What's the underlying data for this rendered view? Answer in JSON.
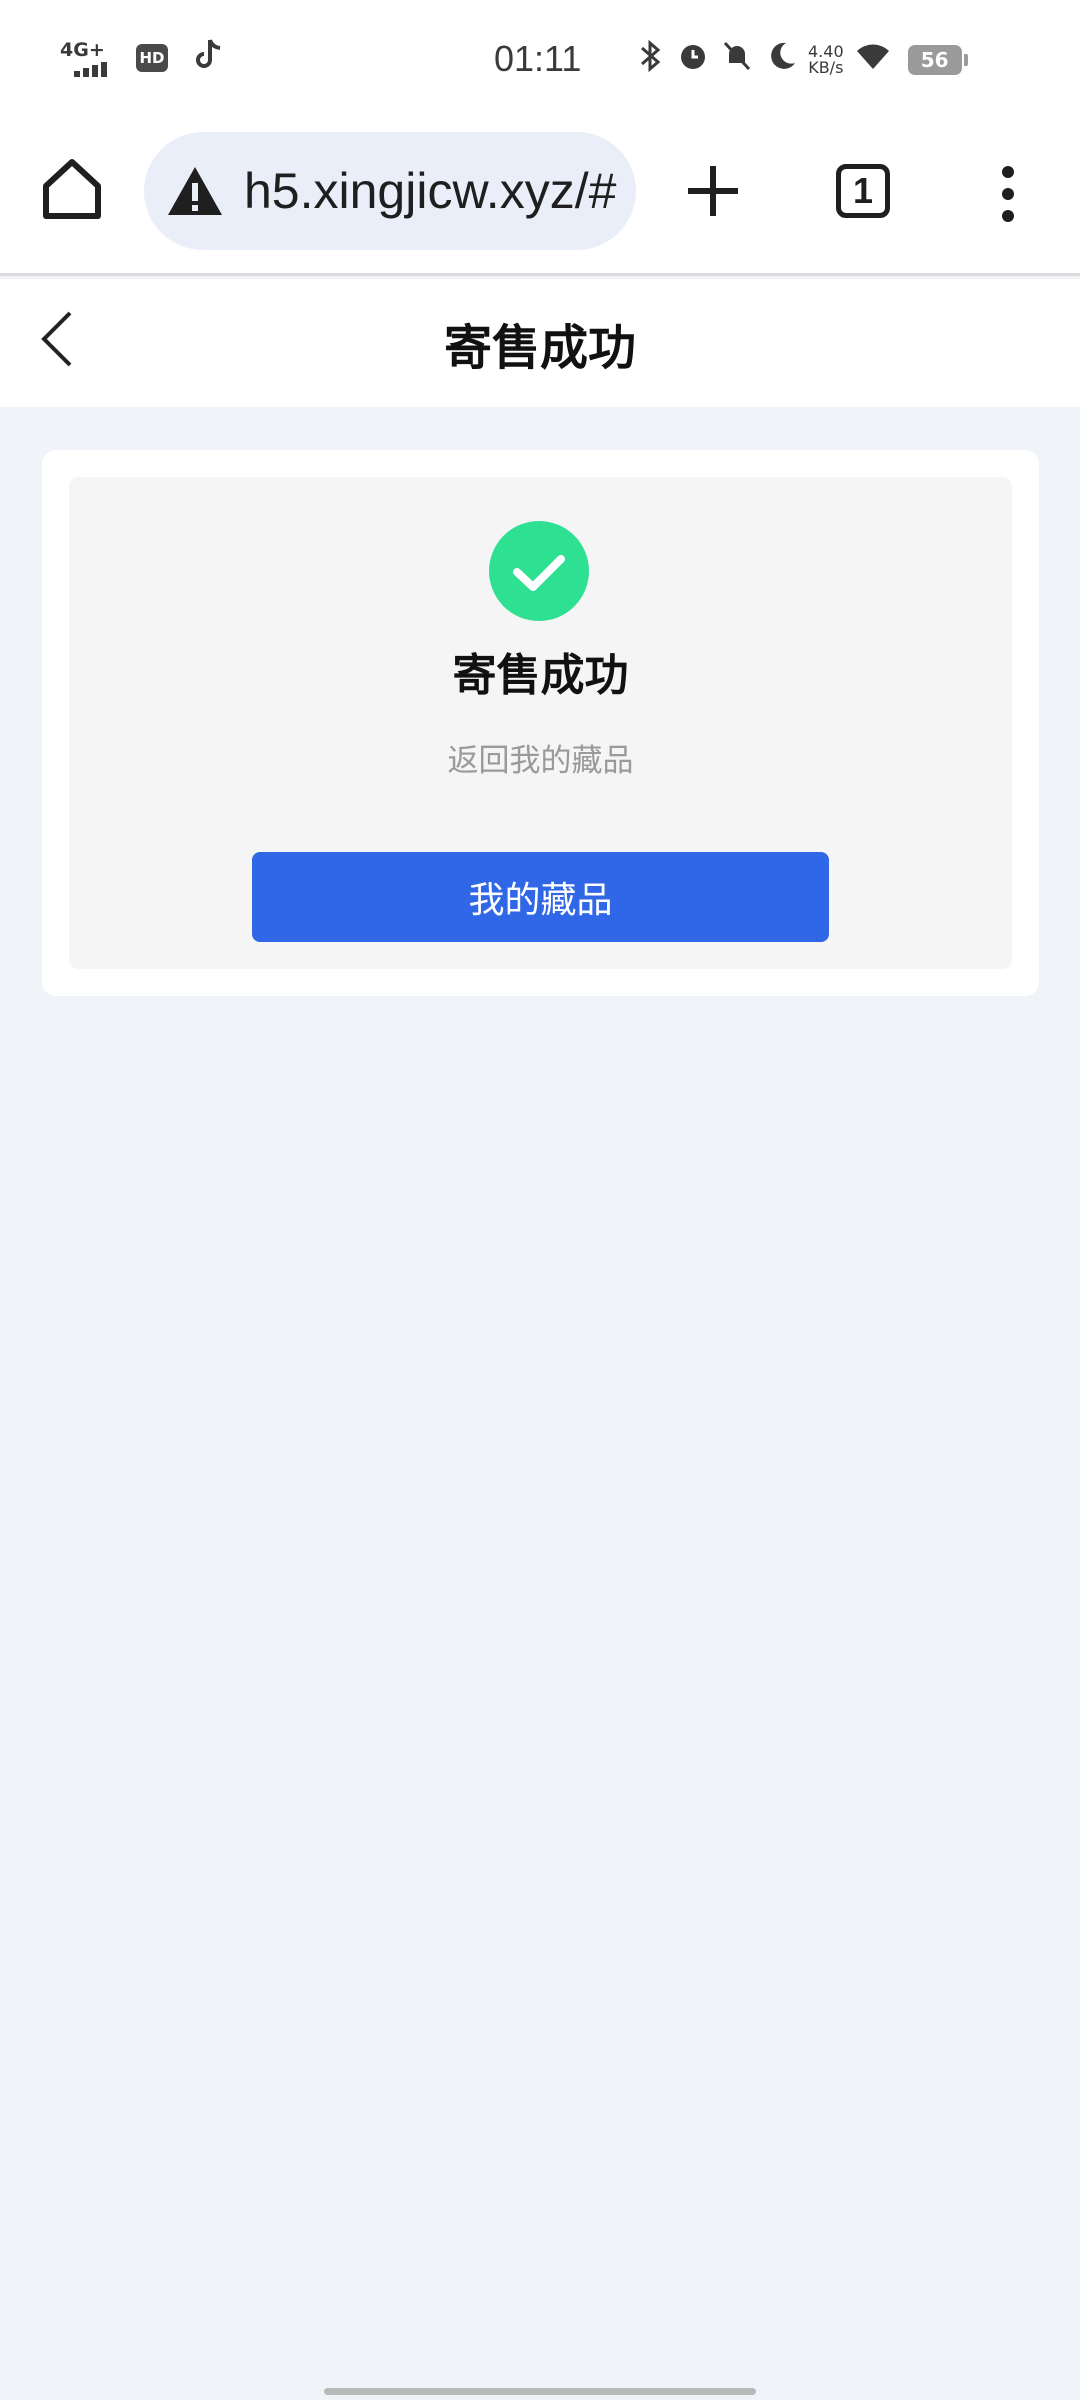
{
  "status_bar": {
    "network": "4G+",
    "hd_badge": "HD",
    "app_icon": "tiktok-icon",
    "time": "01:11",
    "speed_value": "4.40",
    "speed_unit": "KB/s",
    "battery": "56"
  },
  "browser": {
    "url": "h5.xingjicw.xyz/#",
    "tab_count": "1"
  },
  "header": {
    "title": "寄售成功"
  },
  "result": {
    "title": "寄售成功",
    "subtitle": "返回我的藏品",
    "button_label": "我的藏品",
    "accent_color": "#2ee192",
    "button_color": "#2f67e7"
  }
}
